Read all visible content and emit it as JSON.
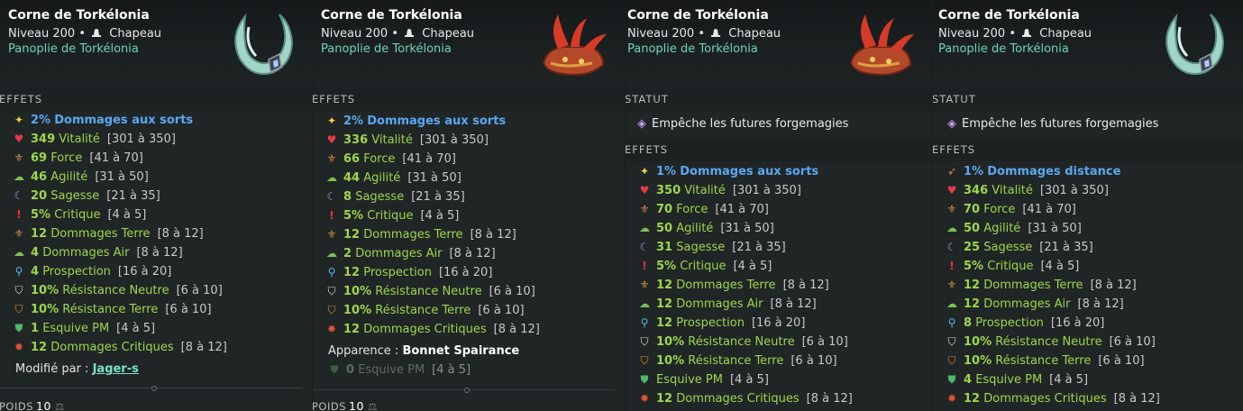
{
  "panels": [
    {
      "title": "Corne de Torkélonia",
      "level": "Niveau 200",
      "type": "Chapeau",
      "panoplie": "Panoplie de Torkélonia",
      "image": "horn-ring",
      "status_label": "",
      "status_text": "",
      "effects_label": "EFFETS",
      "effects": [
        {
          "icon": "star",
          "value": "2%",
          "name": "Dommages aux sorts",
          "range": "",
          "color": "blue"
        },
        {
          "icon": "heart",
          "value": "349",
          "name": "Vitalité",
          "range": "[301 à 350]",
          "color": "green"
        },
        {
          "icon": "strength",
          "value": "69",
          "name": "Force",
          "range": "[41 à 70]",
          "color": "green"
        },
        {
          "icon": "cloud",
          "value": "46",
          "name": "Agilité",
          "range": "[31 à 50]",
          "color": "green"
        },
        {
          "icon": "moon",
          "value": "20",
          "name": "Sagesse",
          "range": "[21 à 35]",
          "color": "green"
        },
        {
          "icon": "excl",
          "value": "5%",
          "name": "Critique",
          "range": "[4 à 5]",
          "color": "green"
        },
        {
          "icon": "strength",
          "value": "12",
          "name": "Dommages Terre",
          "range": "[8 à 12]",
          "color": "green"
        },
        {
          "icon": "cloud",
          "value": "4",
          "name": "Dommages Air",
          "range": "[8 à 12]",
          "color": "green"
        },
        {
          "icon": "magnifier",
          "value": "4",
          "name": "Prospection",
          "range": "[16 à 20]",
          "color": "green"
        },
        {
          "icon": "shield-n",
          "value": "10%",
          "name": "Résistance Neutre",
          "range": "[6 à 10]",
          "color": "green"
        },
        {
          "icon": "shield-t",
          "value": "10%",
          "name": "Résistance Terre",
          "range": "[6 à 10]",
          "color": "green"
        },
        {
          "icon": "shield-pm",
          "value": "1",
          "name": "Esquive PM",
          "range": "[4 à 5]",
          "color": "green"
        },
        {
          "icon": "bug",
          "value": "12",
          "name": "Dommages Critiques",
          "range": "[8 à 12]",
          "color": "green"
        }
      ],
      "modified_label": "Modifié par :",
      "modified_by": "Jager-s",
      "weight_label": "POIDS",
      "weight": "10"
    },
    {
      "title": "Corne de Torkélonia",
      "level": "Niveau 200",
      "type": "Chapeau",
      "panoplie": "Panoplie de Torkélonia",
      "image": "red-hat",
      "effects_label": "EFFETS",
      "effects": [
        {
          "icon": "star",
          "value": "2%",
          "name": "Dommages aux sorts",
          "range": "",
          "color": "blue"
        },
        {
          "icon": "heart",
          "value": "336",
          "name": "Vitalité",
          "range": "[301 à 350]",
          "color": "green"
        },
        {
          "icon": "strength",
          "value": "66",
          "name": "Force",
          "range": "[41 à 70]",
          "color": "green"
        },
        {
          "icon": "cloud",
          "value": "44",
          "name": "Agilité",
          "range": "[31 à 50]",
          "color": "green"
        },
        {
          "icon": "moon",
          "value": "8",
          "name": "Sagesse",
          "range": "[21 à 35]",
          "color": "green"
        },
        {
          "icon": "excl",
          "value": "5%",
          "name": "Critique",
          "range": "[4 à 5]",
          "color": "green"
        },
        {
          "icon": "strength",
          "value": "12",
          "name": "Dommages Terre",
          "range": "[8 à 12]",
          "color": "green"
        },
        {
          "icon": "cloud",
          "value": "2",
          "name": "Dommages Air",
          "range": "[8 à 12]",
          "color": "green"
        },
        {
          "icon": "magnifier",
          "value": "12",
          "name": "Prospection",
          "range": "[16 à 20]",
          "color": "green"
        },
        {
          "icon": "shield-n",
          "value": "10%",
          "name": "Résistance Neutre",
          "range": "[6 à 10]",
          "color": "green"
        },
        {
          "icon": "shield-t",
          "value": "10%",
          "name": "Résistance Terre",
          "range": "[6 à 10]",
          "color": "green"
        },
        {
          "icon": "bug",
          "value": "12",
          "name": "Dommages Critiques",
          "range": "[8 à 12]",
          "color": "green"
        }
      ],
      "appearance_label": "Apparence :",
      "appearance_value": "Bonnet Spairance",
      "faded_effect": {
        "icon": "shield-pm",
        "value": "0",
        "name": "Esquive PM",
        "range": "[4 à 5]"
      },
      "weight_label": "POIDS",
      "weight": "10"
    },
    {
      "title": "Corne de Torkélonia",
      "level": "Niveau 200",
      "type": "Chapeau",
      "panoplie": "Panoplie de Torkélonia",
      "image": "red-hat",
      "status_label": "STATUT",
      "status_text": "Empêche les futures forgemagies",
      "effects_label": "EFFETS",
      "effects": [
        {
          "icon": "star",
          "value": "1%",
          "name": "Dommages aux sorts",
          "range": "",
          "color": "blue"
        },
        {
          "icon": "heart",
          "value": "350",
          "name": "Vitalité",
          "range": "[301 à 350]",
          "color": "green"
        },
        {
          "icon": "strength",
          "value": "70",
          "name": "Force",
          "range": "[41 à 70]",
          "color": "green"
        },
        {
          "icon": "cloud",
          "value": "50",
          "name": "Agilité",
          "range": "[31 à 50]",
          "color": "green"
        },
        {
          "icon": "moon",
          "value": "31",
          "name": "Sagesse",
          "range": "[21 à 35]",
          "color": "green"
        },
        {
          "icon": "excl",
          "value": "5%",
          "name": "Critique",
          "range": "[4 à 5]",
          "color": "green"
        },
        {
          "icon": "strength",
          "value": "12",
          "name": "Dommages Terre",
          "range": "[8 à 12]",
          "color": "green"
        },
        {
          "icon": "cloud",
          "value": "12",
          "name": "Dommages Air",
          "range": "[8 à 12]",
          "color": "green"
        },
        {
          "icon": "magnifier",
          "value": "12",
          "name": "Prospection",
          "range": "[16 à 20]",
          "color": "green"
        },
        {
          "icon": "shield-n",
          "value": "10%",
          "name": "Résistance Neutre",
          "range": "[6 à 10]",
          "color": "green"
        },
        {
          "icon": "shield-t",
          "value": "10%",
          "name": "Résistance Terre",
          "range": "[6 à 10]",
          "color": "green"
        },
        {
          "icon": "shield-pm",
          "value": "",
          "name": "Esquive PM",
          "range": "[4 à 5]",
          "color": "green"
        },
        {
          "icon": "bug",
          "value": "12",
          "name": "Dommages Critiques",
          "range": "[8 à 12]",
          "color": "green"
        }
      ]
    },
    {
      "title": "Corne de Torkélonia",
      "level": "Niveau 200",
      "type": "Chapeau",
      "panoplie": "Panoplie de Torkélonia",
      "image": "horn-ring",
      "status_label": "STATUT",
      "status_text": "Empêche les futures forgemagies",
      "effects_label": "EFFETS",
      "effects": [
        {
          "icon": "bow",
          "value": "1%",
          "name": "Dommages distance",
          "range": "",
          "color": "blue"
        },
        {
          "icon": "heart",
          "value": "346",
          "name": "Vitalité",
          "range": "[301 à 350]",
          "color": "green"
        },
        {
          "icon": "strength",
          "value": "70",
          "name": "Force",
          "range": "[41 à 70]",
          "color": "green"
        },
        {
          "icon": "cloud",
          "value": "50",
          "name": "Agilité",
          "range": "[31 à 50]",
          "color": "green"
        },
        {
          "icon": "moon",
          "value": "25",
          "name": "Sagesse",
          "range": "[21 à 35]",
          "color": "green"
        },
        {
          "icon": "excl",
          "value": "5%",
          "name": "Critique",
          "range": "[4 à 5]",
          "color": "green"
        },
        {
          "icon": "strength",
          "value": "12",
          "name": "Dommages Terre",
          "range": "[8 à 12]",
          "color": "green"
        },
        {
          "icon": "cloud",
          "value": "12",
          "name": "Dommages Air",
          "range": "[8 à 12]",
          "color": "green"
        },
        {
          "icon": "magnifier",
          "value": "8",
          "name": "Prospection",
          "range": "[16 à 20]",
          "color": "green"
        },
        {
          "icon": "shield-n",
          "value": "10%",
          "name": "Résistance Neutre",
          "range": "[6 à 10]",
          "color": "green"
        },
        {
          "icon": "shield-t",
          "value": "10%",
          "name": "Résistance Terre",
          "range": "[6 à 10]",
          "color": "green"
        },
        {
          "icon": "shield-pm",
          "value": "4",
          "name": "Esquive PM",
          "range": "[4 à 5]",
          "color": "green"
        },
        {
          "icon": "bug",
          "value": "12",
          "name": "Dommages Critiques",
          "range": "[8 à 12]",
          "color": "green"
        }
      ]
    }
  ],
  "colors": {
    "stat_green": "#9ed64a",
    "stat_blue": "#5aa8f0",
    "panoplie": "#6fd3b6",
    "faded": "#5f6a64"
  }
}
